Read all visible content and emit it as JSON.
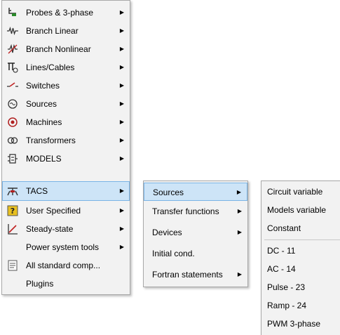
{
  "menu_main": {
    "items": [
      {
        "label": "Probes & 3-phase",
        "icon": "probe-icon",
        "has_submenu": true
      },
      {
        "label": "Branch Linear",
        "icon": "resistor-icon",
        "has_submenu": true
      },
      {
        "label": "Branch Nonlinear",
        "icon": "nonlinear-branch-icon",
        "has_submenu": true
      },
      {
        "label": "Lines/Cables",
        "icon": "line-cable-icon",
        "has_submenu": true
      },
      {
        "label": "Switches",
        "icon": "switch-icon",
        "has_submenu": true
      },
      {
        "label": "Sources",
        "icon": "source-icon",
        "has_submenu": true
      },
      {
        "label": "Machines",
        "icon": "machine-icon",
        "has_submenu": true
      },
      {
        "label": "Transformers",
        "icon": "transformer-icon",
        "has_submenu": true
      },
      {
        "label": "MODELS",
        "icon": "models-icon",
        "has_submenu": true
      },
      {
        "label": "TACS",
        "icon": "tacs-icon",
        "has_submenu": true,
        "selected": true
      },
      {
        "label": "User Specified",
        "icon": "user-specified-icon",
        "has_submenu": true
      },
      {
        "label": "Steady-state",
        "icon": "steady-state-icon",
        "has_submenu": true
      },
      {
        "label": "Power system tools",
        "icon": "",
        "has_submenu": true
      },
      {
        "label": "All standard comp...",
        "icon": "all-components-icon",
        "has_submenu": false
      },
      {
        "label": "Plugins",
        "icon": "",
        "has_submenu": false
      }
    ]
  },
  "menu_tacs": {
    "items": [
      {
        "label": "Sources",
        "has_submenu": true,
        "selected": true
      },
      {
        "label": "Transfer functions",
        "has_submenu": true
      },
      {
        "label": "Devices",
        "has_submenu": true
      },
      {
        "label": "Initial cond.",
        "has_submenu": false
      },
      {
        "label": "Fortran statements",
        "has_submenu": true
      }
    ]
  },
  "menu_sources": {
    "items": [
      {
        "label": "Circuit variable"
      },
      {
        "label": "Models variable"
      },
      {
        "label": "Constant"
      },
      {
        "label": "DC - 11"
      },
      {
        "label": "AC - 14"
      },
      {
        "label": "Pulse - 23"
      },
      {
        "label": "Ramp - 24"
      },
      {
        "label": "PWM 3-phase"
      }
    ]
  },
  "arrow_glyph": "▶",
  "colors": {
    "menu_bg": "#f2f2f2",
    "highlight_bg": "#cde4f7",
    "highlight_border": "#7ab4e6"
  }
}
